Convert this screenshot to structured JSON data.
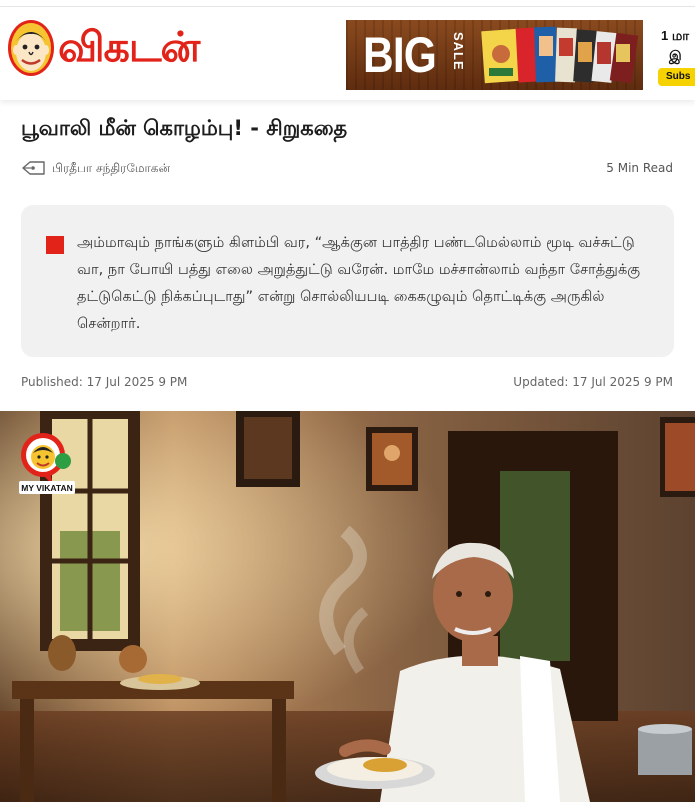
{
  "header": {
    "logo_text": "விகடன்",
    "ad": {
      "big": "BIG",
      "sale": "SALE",
      "line1": "1 மா",
      "line2": "இ",
      "cta": "Subs"
    }
  },
  "article": {
    "title": "பூவாலி மீன் கொழம்பு! - சிறுகதை",
    "author": "பிரதீபா சந்திரமோகன்",
    "read_time": "5 Min Read",
    "summary": "அம்மாவும் நாங்களும் கிளம்பி வர, “ஆக்குன பாத்திர பண்டமெல்லாம் மூடி வச்சுட்டு வா, நா போயி பத்து எலை அறுத்துட்டு வரேன். மாமே மச்சான்லாம் வந்தா சோத்துக்கு தட்டுகெட்டு நிக்கப்புடாது” என்று சொல்லியபடி கைகழுவும் தொட்டிக்கு அருகில் சென்றார்.",
    "published": "Published: 17 Jul 2025 9 PM",
    "updated": "Updated: 17 Jul 2025 9 PM"
  },
  "hero": {
    "badge_text": "MY VIKATAN"
  },
  "colors": {
    "brand_red": "#e2231a",
    "summary_bg": "#f1f1f1",
    "ad_yellow": "#f5d200"
  },
  "icons": [
    "vikatan-mascot-icon",
    "author-pen-icon",
    "my-vikatan-badge-icon"
  ]
}
